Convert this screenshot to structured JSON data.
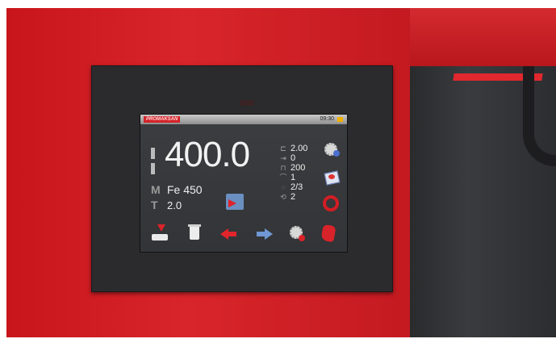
{
  "screen": {
    "brand": "PROMAKSAN",
    "time": "09:30",
    "main_value": "400.0",
    "material": "Fe 450",
    "thickness": "2.0",
    "material_icon": "M",
    "thickness_icon": "T"
  },
  "params": [
    {
      "icon": "pressure-icon",
      "glyph": "⊏",
      "value": "2.00"
    },
    {
      "icon": "backgauge-icon",
      "glyph": "⇥",
      "value": "0"
    },
    {
      "icon": "width-icon",
      "glyph": "⊓",
      "value": "200"
    },
    {
      "icon": "angle-icon",
      "glyph": "⌒",
      "value": "1"
    },
    {
      "icon": "step-icon",
      "glyph": "◌",
      "value": "2/3"
    },
    {
      "icon": "count-icon",
      "glyph": "⟲",
      "value": "2"
    }
  ],
  "toolbar": [
    {
      "name": "load-program-button",
      "icon": "tray-download-icon"
    },
    {
      "name": "delete-button",
      "icon": "trash-icon"
    },
    {
      "name": "previous-button",
      "icon": "arrow-left-icon"
    },
    {
      "name": "next-button",
      "icon": "arrow-right-icon"
    },
    {
      "name": "tool-settings-button",
      "icon": "gear-icon"
    },
    {
      "name": "manual-mode-button",
      "icon": "hand-icon"
    }
  ],
  "colors": {
    "machine_red": "#d8252b",
    "bezel": "#2b2b2d",
    "screen_bg": "#36383b",
    "accent_red": "#d8232a",
    "accent_blue": "#6f98d4"
  }
}
